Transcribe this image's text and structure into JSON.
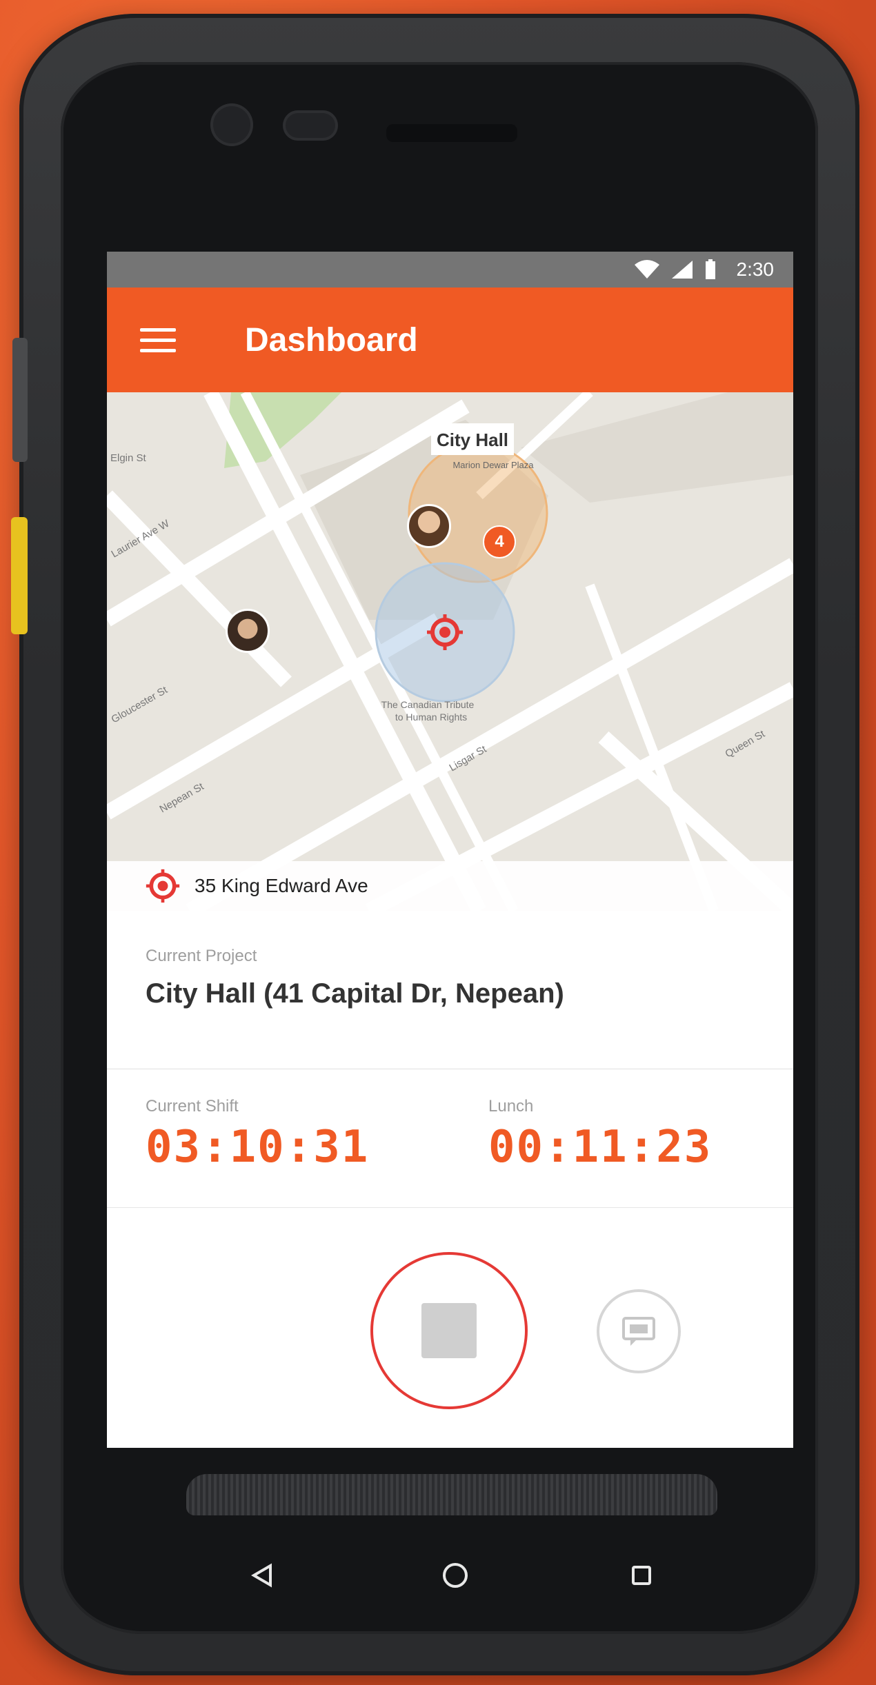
{
  "status_bar": {
    "time": "2:30"
  },
  "app_bar": {
    "title": "Dashboard"
  },
  "map": {
    "poi_title": "City Hall",
    "poi_subtitle": "Marion Dewar Plaza",
    "cluster_count": "4",
    "place_label_line1": "The Canadian Tribute",
    "place_label_line2": "to Human Rights",
    "streets": [
      "Queen St",
      "Laurier Ave W",
      "Lisgar St",
      "Nepean St",
      "Gloucester St",
      "Elgin St"
    ],
    "address": "35 King Edward Ave"
  },
  "project": {
    "label": "Current Project",
    "value": "City Hall (41 Capital Dr, Nepean)"
  },
  "timers": {
    "shift_label": "Current Shift",
    "shift_value": "03:10:31",
    "lunch_label": "Lunch",
    "lunch_value": "00:11:23"
  },
  "colors": {
    "accent": "#f05a24",
    "stop_ring": "#e53935",
    "background": "#e4572a"
  },
  "icons": {
    "menu": "menu-icon",
    "location": "location-target-icon",
    "stop": "stop-icon",
    "chat": "chat-icon",
    "back": "back-triangle-icon",
    "home": "home-circle-icon",
    "recents": "recents-square-icon"
  }
}
